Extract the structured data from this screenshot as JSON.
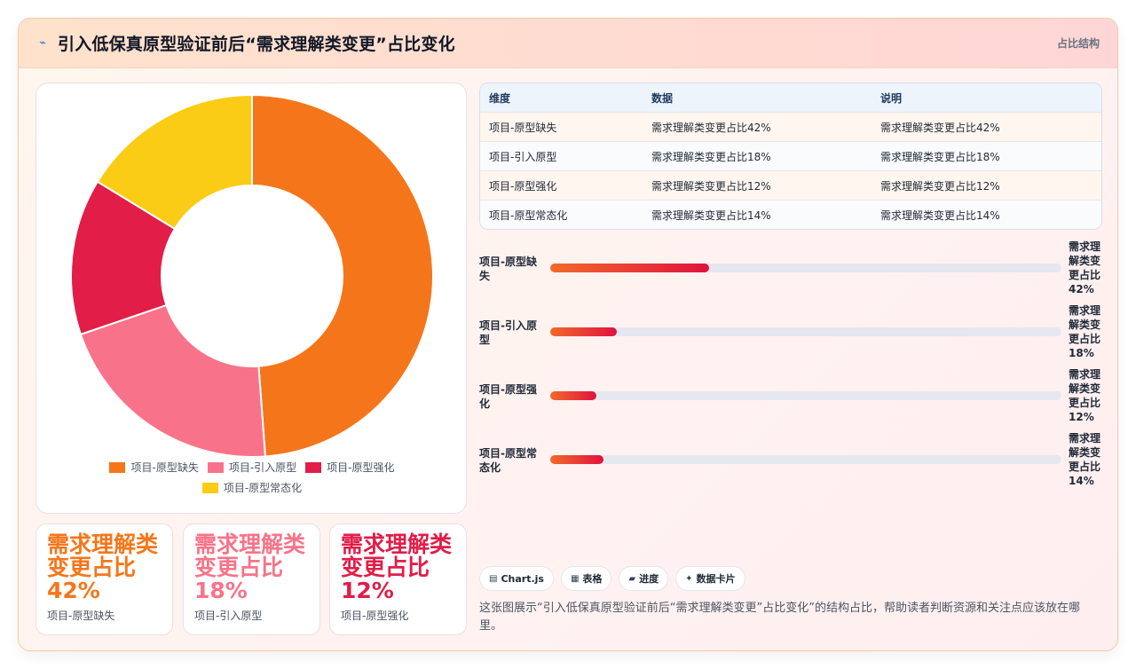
{
  "header": {
    "icon": "bolt-icon",
    "title": "引入低保真原型验证前后“需求理解类变更”占比变化",
    "tag": "占比结构"
  },
  "chart_data": {
    "type": "pie",
    "variant": "doughnut",
    "categories": [
      "项目-原型缺失",
      "项目-引入原型",
      "项目-原型强化",
      "项目-原型常态化"
    ],
    "values": [
      42,
      18,
      12,
      14
    ],
    "colors": [
      "#f5761a",
      "#f87389",
      "#e11d48",
      "#facc15"
    ],
    "legend_placement": "bottom"
  },
  "legend": [
    {
      "label": "项目-原型缺失",
      "color": "#f5761a"
    },
    {
      "label": "项目-引入原型",
      "color": "#f87389"
    },
    {
      "label": "项目-原型强化",
      "color": "#e11d48"
    },
    {
      "label": "项目-原型常态化",
      "color": "#facc15"
    }
  ],
  "stats": [
    {
      "value": "需求理解类变更占比42%",
      "label": "项目-原型缺失",
      "color": "#f5761a"
    },
    {
      "value": "需求理解类变更占比18%",
      "label": "项目-引入原型",
      "color": "#f87389"
    },
    {
      "value": "需求理解类变更占比12%",
      "label": "项目-原型强化",
      "color": "#e11d48"
    }
  ],
  "table": {
    "headers": [
      "维度",
      "数据",
      "说明"
    ],
    "rows": [
      [
        "项目-原型缺失",
        "需求理解类变更占比42%",
        "需求理解类变更占比42%"
      ],
      [
        "项目-引入原型",
        "需求理解类变更占比18%",
        "需求理解类变更占比18%"
      ],
      [
        "项目-原型强化",
        "需求理解类变更占比12%",
        "需求理解类变更占比12%"
      ],
      [
        "项目-原型常态化",
        "需求理解类变更占比14%",
        "需求理解类变更占比14%"
      ]
    ]
  },
  "bars": [
    {
      "label": "项目-原型缺失",
      "value_text": "需求理解类变更占比42%",
      "percent": 31
    },
    {
      "label": "项目-引入原型",
      "value_text": "需求理解类变更占比18%",
      "percent": 13
    },
    {
      "label": "项目-原型强化",
      "value_text": "需求理解类变更占比12%",
      "percent": 9
    },
    {
      "label": "项目-原型常态化",
      "value_text": "需求理解类变更占比14%",
      "percent": 10.5
    }
  ],
  "chips": [
    {
      "icon": "chart-icon",
      "glyph": "▤",
      "label": "Chart.js"
    },
    {
      "icon": "table-icon",
      "glyph": "▦",
      "label": "表格"
    },
    {
      "icon": "progress-icon",
      "glyph": "▰",
      "label": "进度"
    },
    {
      "icon": "sparkle-icon",
      "glyph": "✦",
      "label": "数据卡片"
    }
  ],
  "description": "这张图展示“引入低保真原型验证前后“需求理解类变更”占比变化”的结构占比，帮助读者判断资源和关注点应该放在哪里。"
}
